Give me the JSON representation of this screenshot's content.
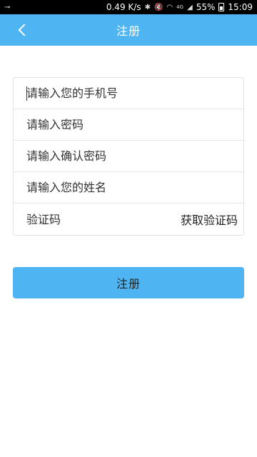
{
  "status_bar": {
    "key_icon": "⊸",
    "speed": "0.49 K/s",
    "network_type": "4G",
    "battery_percent": "55%",
    "time": "15:09"
  },
  "header": {
    "title": "注册",
    "back_icon": "chevron-left"
  },
  "form": {
    "phone_placeholder": "请输入您的手机号",
    "password_placeholder": "请输入密码",
    "confirm_password_placeholder": "请输入确认密码",
    "name_placeholder": "请输入您的姓名",
    "code_placeholder": "验证码",
    "get_code_label": "获取验证码"
  },
  "register_button_label": "注册",
  "colors": {
    "accent": "#4fb5f2"
  }
}
